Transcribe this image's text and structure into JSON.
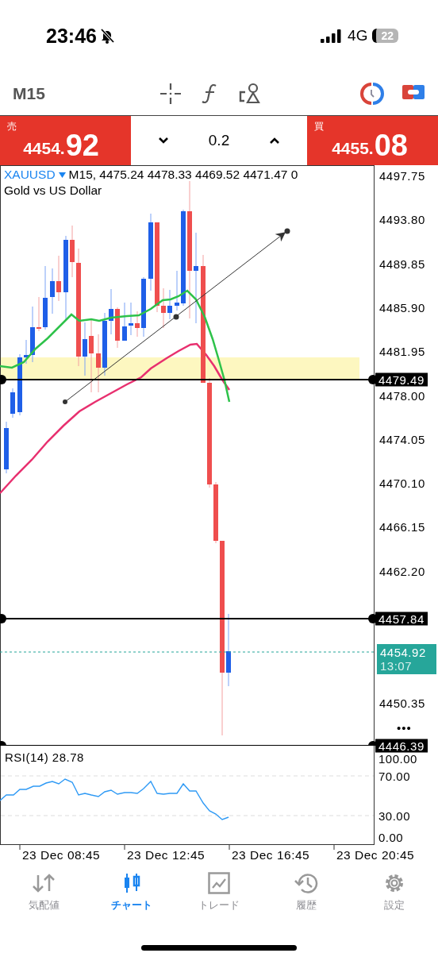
{
  "status_bar": {
    "time": "23:46",
    "network": "4G",
    "battery": "22"
  },
  "toolbar": {
    "timeframe": "M15"
  },
  "trade_bar": {
    "sell": {
      "label": "売",
      "price_small": "4454.",
      "price_big": "92"
    },
    "volume": "0.2",
    "buy": {
      "label": "買",
      "price_small": "4455.",
      "price_big": "08"
    }
  },
  "chart": {
    "symbol": "XAUUSD",
    "ohlc": "M15, 4475.24 4478.33 4469.52 4471.47 0",
    "description": "Gold vs US Dollar",
    "price_scale": [
      "4497.75",
      "4493.80",
      "4489.85",
      "4485.90",
      "4481.95",
      "4478.00",
      "4474.05",
      "4470.10",
      "4466.15",
      "4462.20",
      "4450.35"
    ],
    "lines": [
      {
        "label": "4479.49"
      },
      {
        "label": "4457.84"
      },
      {
        "label": "4446.39"
      }
    ],
    "current_price": "4454.92",
    "countdown": "13:07",
    "more": "•••"
  },
  "rsi": {
    "label": "RSI(14) 28.78",
    "scale": [
      "100.00",
      "70.00",
      "30.00",
      "0.00"
    ]
  },
  "time_axis": [
    "23 Dec 08:45",
    "23 Dec 12:45",
    "23 Dec 16:45",
    "23 Dec 20:45"
  ],
  "tabs": [
    {
      "kind": "quotes",
      "label": "気配値",
      "selected": false
    },
    {
      "kind": "chart",
      "label": "チャート",
      "selected": true
    },
    {
      "kind": "trade",
      "label": "トレード",
      "selected": false
    },
    {
      "kind": "history",
      "label": "履歴",
      "selected": false
    },
    {
      "kind": "settings",
      "label": "設定",
      "selected": false
    }
  ]
}
